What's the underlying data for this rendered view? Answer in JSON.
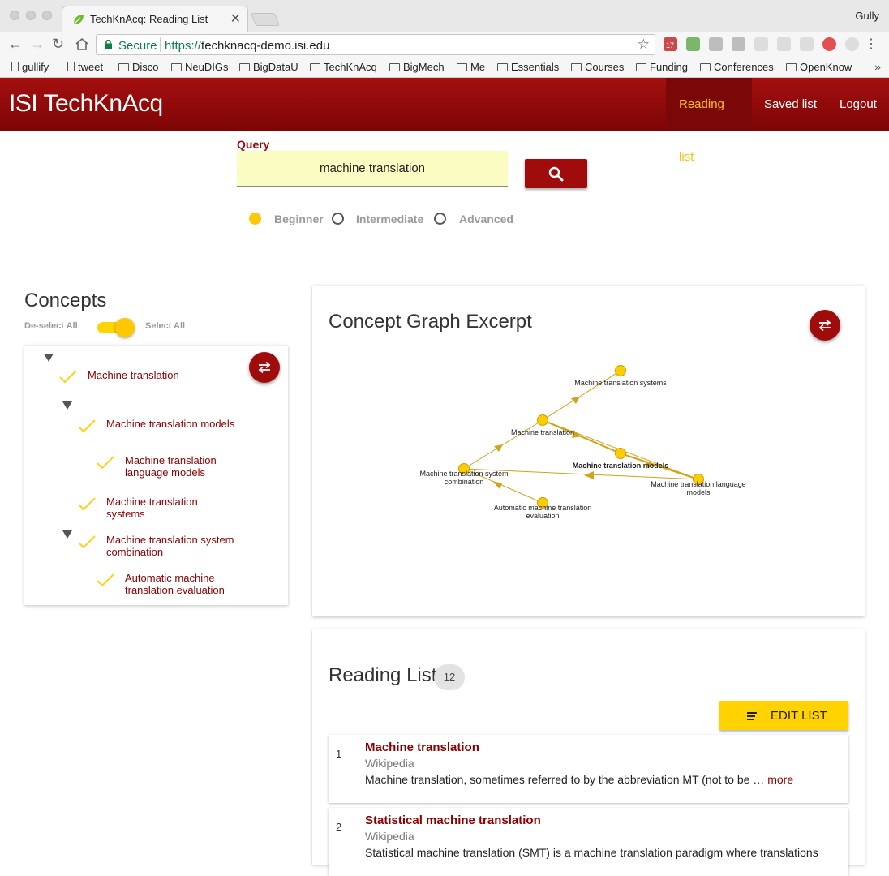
{
  "browser": {
    "tab_title": "TechKnAcq: Reading List",
    "tab_close": "✕",
    "profile": "Gully",
    "secure_label": "Secure",
    "url_scheme": "https://",
    "url_host": "techknacq-demo.isi.edu",
    "calendar_day": "17",
    "bookmarks": [
      "gullify",
      "tweet",
      "Disco",
      "NeuDIGs",
      "BigDataU",
      "TechKnAcq",
      "BigMech",
      "Me",
      "Essentials",
      "Courses",
      "Funding",
      "Conferences",
      "OpenKnow"
    ],
    "bookmarks_more": "»"
  },
  "app": {
    "brand": "ISI TechKnAcq",
    "nav": [
      "Reading list",
      "Saved list",
      "Logout"
    ],
    "accent": "#a00c0c",
    "highlight": "#ffc800"
  },
  "query": {
    "label": "Query",
    "value": "machine translation",
    "levels": [
      "Beginner",
      "Intermediate",
      "Advanced"
    ],
    "selected_level": "Beginner"
  },
  "concepts": {
    "title": "Concepts",
    "deselect_all": "De-select All",
    "select_all": "Select All",
    "tree": [
      [
        "Machine translation"
      ],
      [
        "Machine translation models"
      ],
      [
        "Machine translation",
        "language models"
      ],
      [
        "Machine translation",
        "systems"
      ],
      [
        "Machine translation system",
        "combination"
      ],
      [
        "Automatic machine",
        "translation evaluation"
      ]
    ]
  },
  "graph": {
    "title": "Concept Graph Excerpt",
    "nodes": [
      [
        "Machine translation systems"
      ],
      [
        "Machine translation"
      ],
      [
        "Machine translation models"
      ],
      [
        "Machine translation system",
        "combination"
      ],
      [
        "Machine translation language",
        "models"
      ],
      [
        "Automatic machine translation",
        "evaluation"
      ]
    ]
  },
  "reading_list": {
    "title": "Reading List",
    "count": "12",
    "edit_label": "EDIT LIST",
    "items": [
      {
        "num": "1",
        "title": "Machine translation",
        "source": "Wikipedia",
        "snippet": "Machine translation, sometimes referred to by the abbreviation MT (not to be … ",
        "more": "more"
      },
      {
        "num": "2",
        "title": "Statistical machine translation",
        "source": "Wikipedia",
        "snippet": "Statistical machine translation (SMT) is a machine translation paradigm where translations",
        "more": ""
      }
    ]
  }
}
